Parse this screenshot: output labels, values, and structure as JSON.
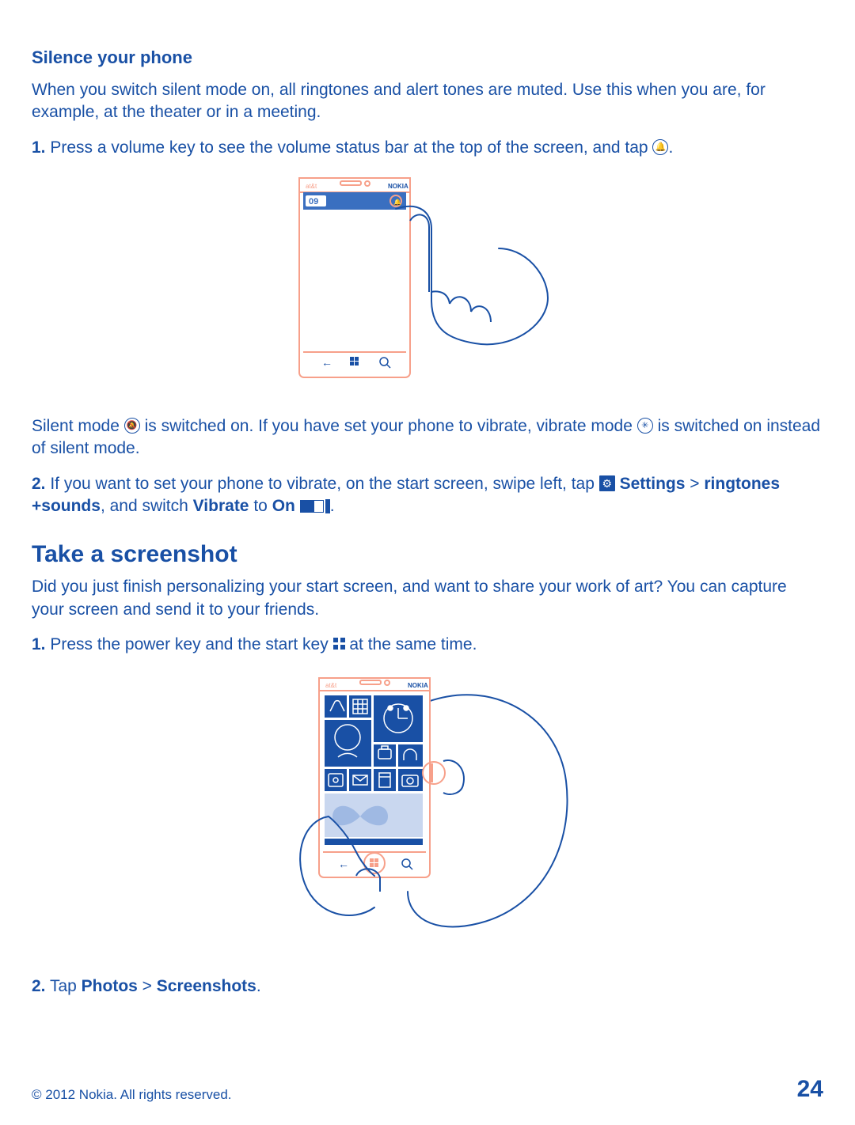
{
  "section1": {
    "title": "Silence your phone",
    "intro": "When you switch silent mode on, all ringtones and alert tones are muted. Use this when you are, for example, at the theater or in a meeting.",
    "step1_num": "1.",
    "step1_text": " Press a volume key to see the volume status bar at the top of the screen, and tap ",
    "step1_end": ".",
    "silent_a": "Silent mode ",
    "silent_b": " is switched on. If you have set your phone to vibrate, vibrate mode ",
    "silent_c": " is switched on instead of silent mode.",
    "step2_num": "2.",
    "step2_a": " If you want to set your phone to vibrate, on the start screen, swipe left, tap ",
    "settings": "Settings",
    "gt1": " > ",
    "ringtones": "ringtones +sounds",
    "step2_b": ", and switch ",
    "vibrate": "Vibrate",
    "to": " to ",
    "on": "On",
    "step2_end": "."
  },
  "section2": {
    "title": "Take a screenshot",
    "intro": "Did you just finish personalizing your start screen, and want to share your work of art? You can capture your screen and send it to your friends.",
    "step1_num": "1.",
    "step1_a": " Press the power key and the start key ",
    "step1_b": " at the same time.",
    "step2_num": "2.",
    "step2_a": " Tap ",
    "photos": "Photos",
    "gt": " > ",
    "screenshots": "Screenshots",
    "step2_end": "."
  },
  "footer": {
    "copyright": "© 2012 Nokia. All rights reserved.",
    "page": "24"
  },
  "icons": {
    "ring": "ring-icon",
    "silent": "silent-mode-icon",
    "vibrate": "vibrate-mode-icon",
    "settings": "settings-icon",
    "toggle": "toggle-on-icon",
    "windows": "windows-start-icon"
  }
}
